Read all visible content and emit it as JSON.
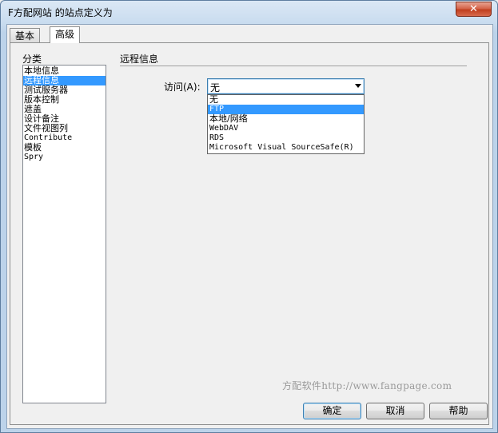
{
  "window": {
    "title": "F方配网站 的站点定义为",
    "close_glyph": "✕"
  },
  "tabs": [
    {
      "label": "基本"
    },
    {
      "label": "高级"
    }
  ],
  "category": {
    "label": "分类",
    "items": [
      "本地信息",
      "远程信息",
      "测试服务器",
      "版本控制",
      "遮盖",
      "设计备注",
      "文件视图列",
      "Contribute",
      "模板",
      "Spry"
    ],
    "selected_index": 1
  },
  "remote": {
    "section_title": "远程信息",
    "access_label": "访问(A):",
    "access_value": "无",
    "options": [
      "无",
      "FTP",
      "本地/网络",
      "WebDAV",
      "RDS",
      "Microsoft Visual SourceSafe(R)"
    ],
    "highlighted_index": 1
  },
  "watermark": "方配软件http://www.fangpage.com",
  "buttons": {
    "ok": "确定",
    "cancel": "取消",
    "help": "帮助"
  }
}
